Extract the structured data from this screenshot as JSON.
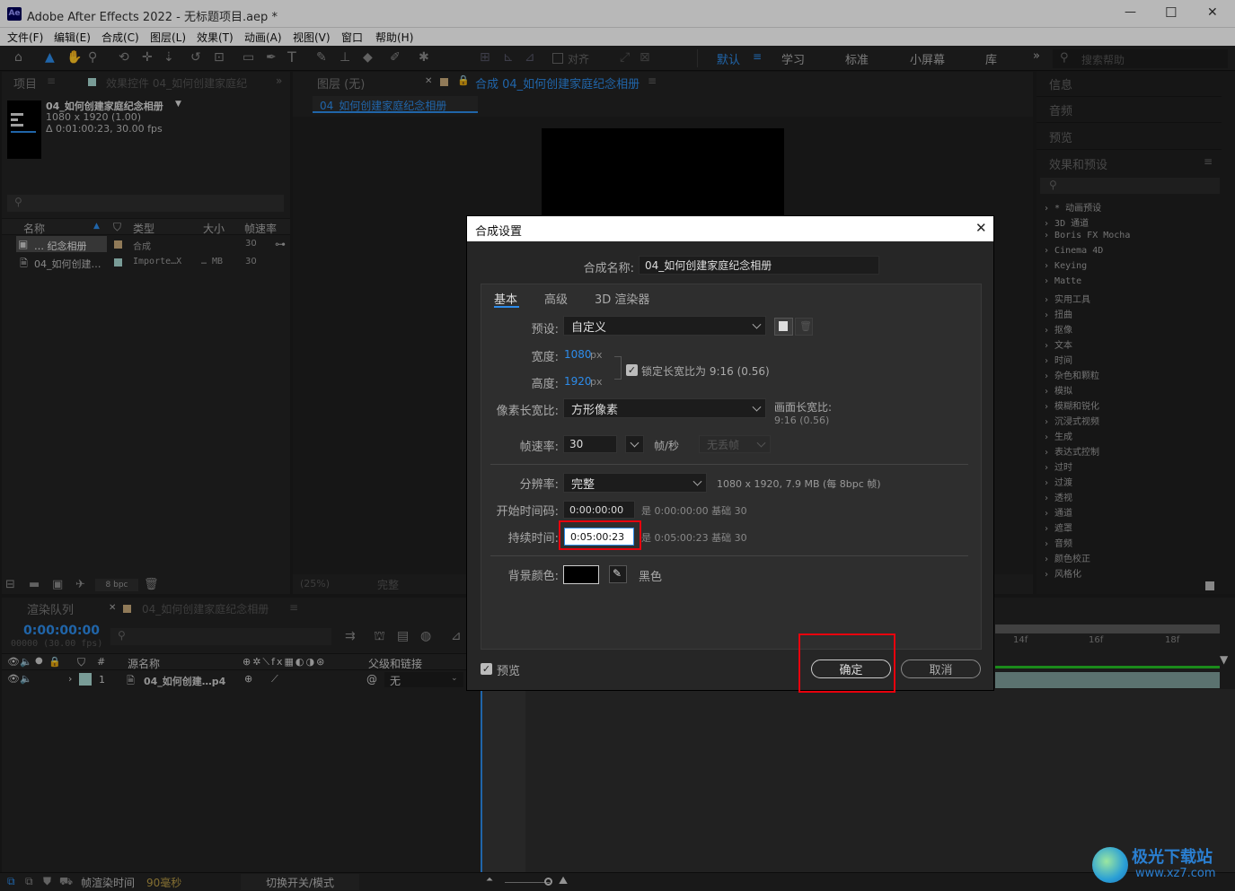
{
  "window": {
    "app_icon": "Ae",
    "title": "Adobe After Effects 2022 - 无标题项目.aep *",
    "minimize": "—",
    "maximize": "☐",
    "close": "✕"
  },
  "menu": [
    "文件(F)",
    "编辑(E)",
    "合成(C)",
    "图层(L)",
    "效果(T)",
    "动画(A)",
    "视图(V)",
    "窗口",
    "帮助(H)"
  ],
  "toolbar": {
    "align_label": "对齐",
    "workspaces": [
      "默认",
      "学习",
      "标准",
      "小屏幕",
      "库"
    ],
    "more": "»",
    "search_placeholder": "搜索帮助"
  },
  "project_panel": {
    "tab_project": "项目",
    "tab_effects": "效果控件 04_如何创建家庭纪",
    "comp_name": "04_如何创建家庭纪念相册",
    "comp_size": "1080 x 1920 (1.00)",
    "comp_duration": "Δ 0:01:00:23, 30.00 fps",
    "search_placeholder": "",
    "columns": [
      "名称",
      "类型",
      "大小",
      "帧速率"
    ],
    "rows": [
      {
        "name": "… 纪念相册",
        "type": "合成",
        "size": "",
        "fps": "30",
        "color": "#c8a97b"
      },
      {
        "name": "04_如何创建…",
        "type": "Importe…X",
        "size": "… MB",
        "fps": "30",
        "color": "#a8d8d2"
      }
    ],
    "bpc": "8 bpc"
  },
  "viewer": {
    "tab_layer": "图层 (无)",
    "tab_comp": "合成 04_如何创建家庭纪念相册",
    "comp_tab_label": "04_如何创建家庭纪念相册",
    "zoom": "(25%)",
    "resolution": "完整"
  },
  "right_panel": {
    "sections": [
      "信息",
      "音频",
      "预览",
      "效果和预设"
    ],
    "effects": [
      "* 动画预设",
      "3D 通道",
      "Boris FX Mocha",
      "Cinema 4D",
      "Keying",
      "Matte",
      "实用工具",
      "扭曲",
      "抠像",
      "文本",
      "时间",
      "杂色和颗粒",
      "模拟",
      "模糊和锐化",
      "沉浸式视频",
      "生成",
      "表达式控制",
      "过时",
      "过渡",
      "透视",
      "通道",
      "遮罩",
      "音频",
      "颜色校正",
      "风格化"
    ]
  },
  "timeline": {
    "tab_render": "渲染队列",
    "tab_comp": "04_如何创建家庭纪念相册",
    "timecode": "0:00:00:00",
    "frame_info": "00000 (30.00 fps)",
    "col_source": "源名称",
    "col_parent": "父级和链接",
    "layer_index": "1",
    "layer_name": "04_如何创建…p4",
    "layer_parent": "无",
    "ruler": [
      "14f",
      "16f",
      "18f"
    ],
    "status_render_label": "帧渲染时间",
    "status_render_value": "90毫秒",
    "toggle_label": "切换开关/模式"
  },
  "dialog": {
    "title": "合成设置",
    "name_label": "合成名称:",
    "name_value": "04_如何创建家庭纪念相册",
    "tabs": [
      "基本",
      "高级",
      "3D 渲染器"
    ],
    "preset_label": "预设:",
    "preset_value": "自定义",
    "width_label": "宽度:",
    "width_value": "1080",
    "height_label": "高度:",
    "height_value": "1920",
    "unit_px": "px",
    "lock_label": "锁定长宽比为 9:16 (0.56)",
    "par_label": "像素长宽比:",
    "par_value": "方形像素",
    "frame_aspect_label": "画面长宽比:",
    "frame_aspect_value": "9:16 (0.56)",
    "fps_label": "帧速率:",
    "fps_value": "30",
    "fps_unit": "帧/秒",
    "drop_frame": "无丢帧",
    "res_label": "分辨率:",
    "res_value": "完整",
    "res_info": "1080 x 1920, 7.9 MB (每 8bpc 帧)",
    "start_label": "开始时间码:",
    "start_value": "0:00:00:00",
    "start_info": "是 0:00:00:00  基础 30",
    "dur_label": "持续时间:",
    "dur_value": "0:05:00:23",
    "dur_info": "是 0:05:00:23  基础 30",
    "bg_label": "背景颜色:",
    "bg_color": "#000000",
    "bg_name": "黑色",
    "preview_label": "预览",
    "ok_label": "确定",
    "cancel_label": "取消"
  },
  "watermark": {
    "brand": "极光下载站",
    "url": "www.xz7.com"
  },
  "colors": {
    "accent": "#2d8ceb",
    "highlight_red": "#e8000d",
    "green_bar": "#26c126"
  }
}
